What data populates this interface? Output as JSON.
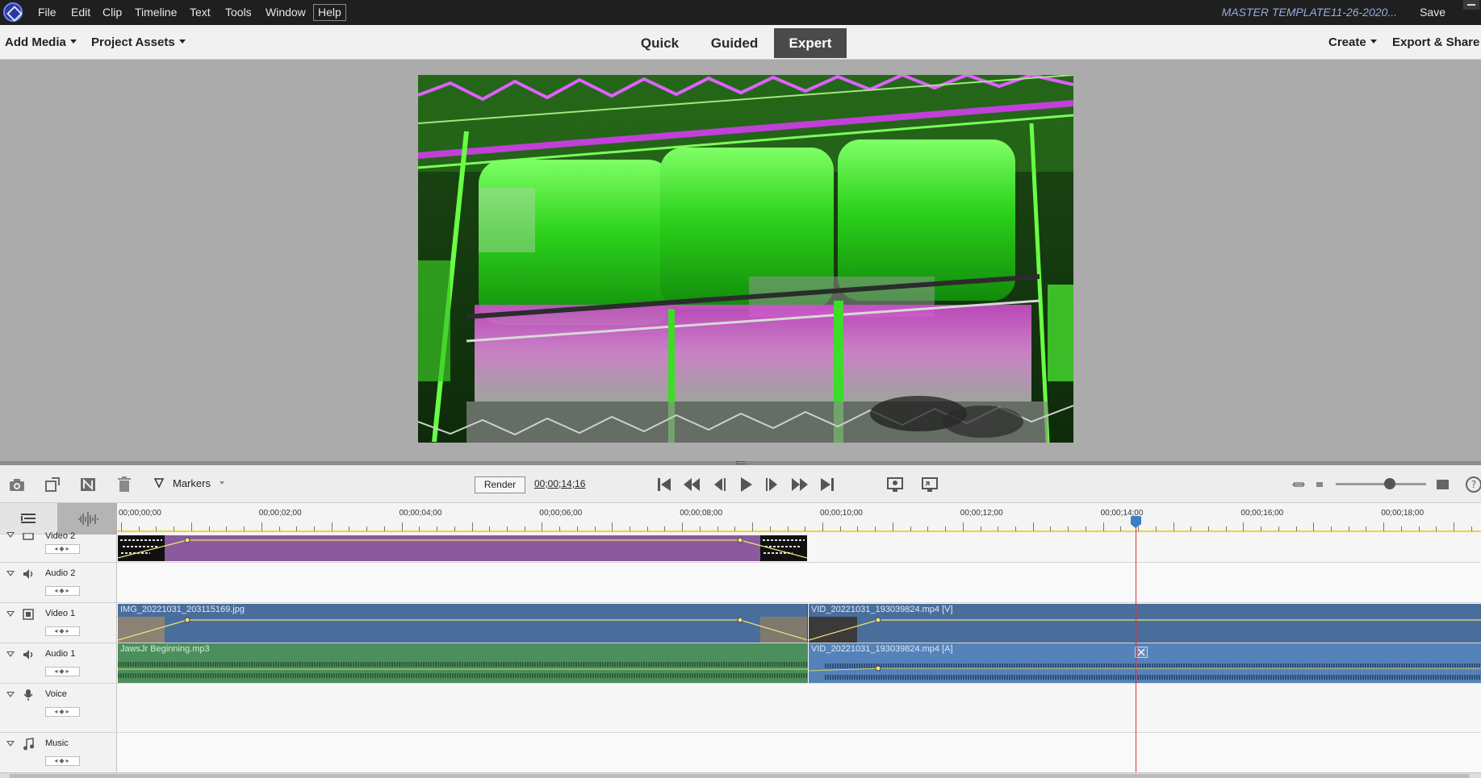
{
  "menu": {
    "items": [
      {
        "label": "File"
      },
      {
        "label": "Edit"
      },
      {
        "label": "Clip"
      },
      {
        "label": "Timeline"
      },
      {
        "label": "Text"
      },
      {
        "label": "Tools"
      },
      {
        "label": "Window"
      },
      {
        "label": "Help"
      }
    ],
    "project_title": "MASTER TEMPLATE11-26-2020...",
    "save_label": "Save"
  },
  "modebar": {
    "add_media": "Add Media",
    "project_assets": "Project Assets",
    "tabs": [
      {
        "label": "Quick",
        "active": false
      },
      {
        "label": "Guided",
        "active": false
      },
      {
        "label": "Expert",
        "active": true
      }
    ],
    "create": "Create",
    "export_share": "Export & Share"
  },
  "toolbar": {
    "markers_label": "Markers",
    "render_label": "Render",
    "timecode": "00;00;14;16",
    "zoom_level": 0.6
  },
  "timeline": {
    "ruler_labels": [
      "00;00;00;00",
      "00;00;02;00",
      "00;00;04;00",
      "00;00;06;00",
      "00;00;08;00",
      "00;00;10;00",
      "00;00;12;00",
      "00;00;14;00",
      "00;00;16;00",
      "00;00;18;00"
    ],
    "tracks": [
      {
        "name": "Video 2",
        "kind": "video"
      },
      {
        "name": "Audio 2",
        "kind": "audio"
      },
      {
        "name": "Video 1",
        "kind": "video"
      },
      {
        "name": "Audio 1",
        "kind": "audio"
      },
      {
        "name": "Voice",
        "kind": "voice"
      },
      {
        "name": "Music",
        "kind": "music"
      }
    ],
    "clips": {
      "video1_a": "IMG_20221031_203115169.jpg",
      "video1_b": "VID_20221031_193039824.mp4 [V]",
      "audio1_a": "JawsJr Beginning.mp3",
      "audio1_b": "VID_20221031_193039824.mp4 [A]"
    }
  },
  "colors": {
    "clip_video": "#4a6e9c",
    "clip_audio_green": "#4a8f5c",
    "clip_audio_blue": "#5582b8",
    "clip_title": "#8a5a9c",
    "playhead": "#e53030"
  }
}
